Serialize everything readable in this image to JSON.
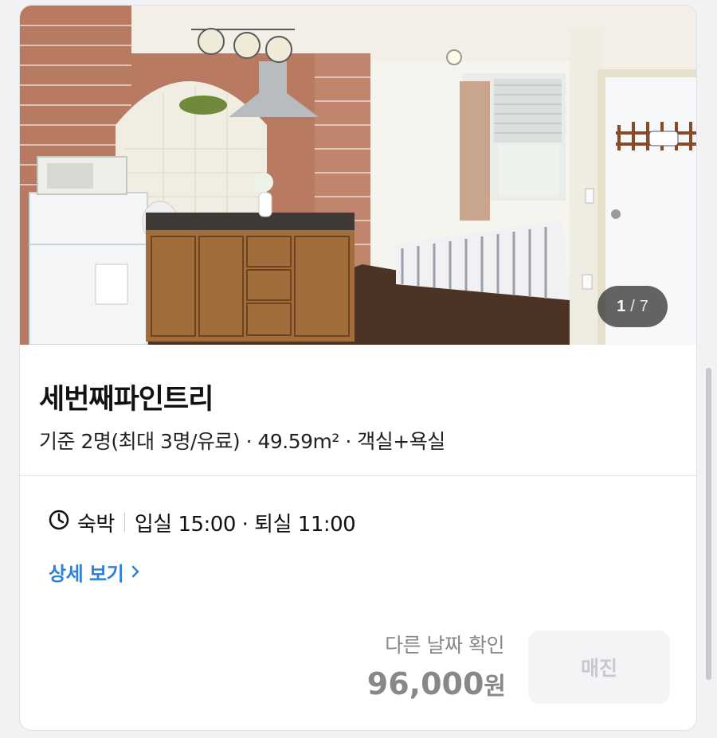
{
  "room": {
    "name": "세번째파인트리",
    "capacity": "기준 2명(최대 3명/유료) · 49.59m² · 객실+욕실"
  },
  "gallery": {
    "current": "1",
    "separator": "/",
    "total": "7"
  },
  "stay": {
    "icon": "clock-icon",
    "type": "숙박",
    "times": "입실 15:00 · 퇴실 11:00"
  },
  "links": {
    "details": "상세 보기"
  },
  "booking": {
    "other_date": "다른 날짜 확인",
    "price": "96,000",
    "currency": "원",
    "status_button": "매진"
  },
  "colors": {
    "link": "#2f80d6",
    "muted_text": "#888888",
    "disabled_button_bg": "#f4f4f6",
    "disabled_button_text": "#c9c9cd"
  }
}
